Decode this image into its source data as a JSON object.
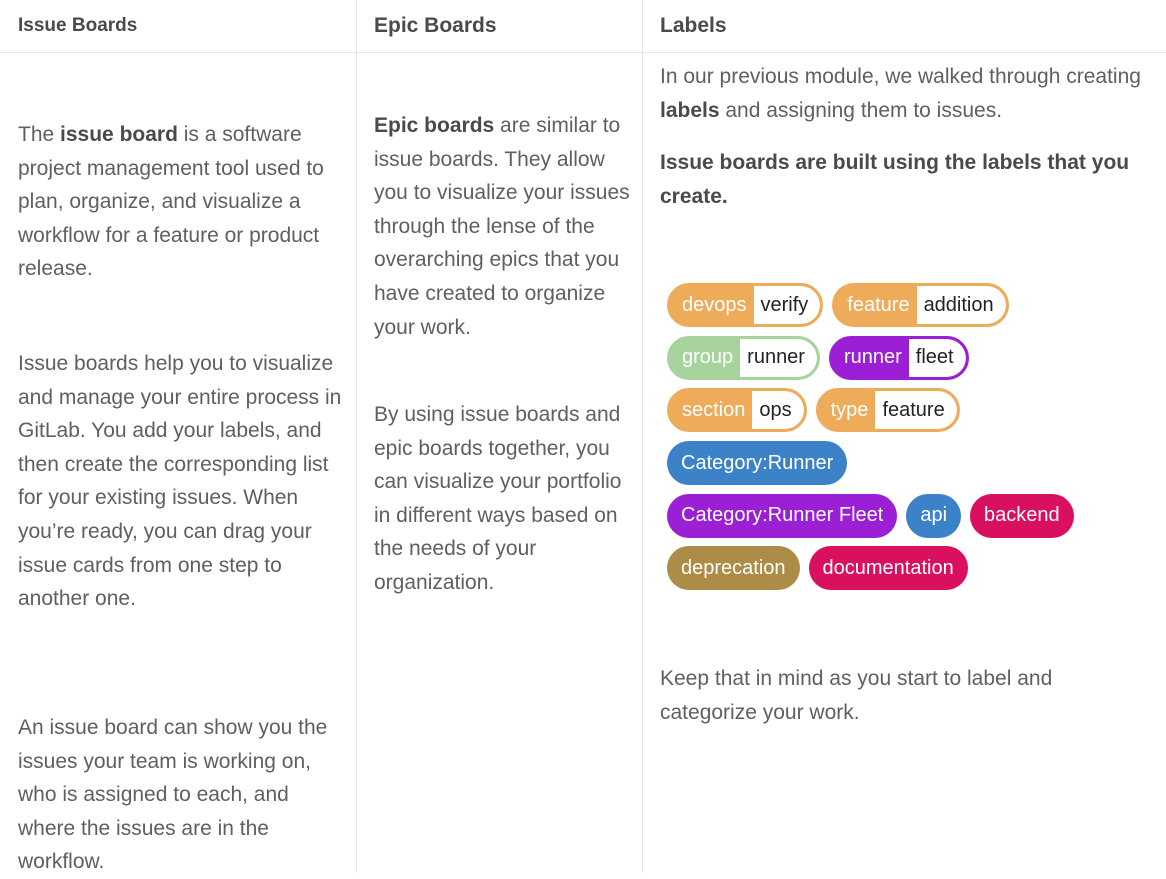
{
  "columns": {
    "issue_boards": {
      "title": "Issue Boards",
      "p1_pre": "The ",
      "p1_bold": "issue board",
      "p1_post": " is a software project management tool used to plan, organize, and visualize a workflow for a feature or product release.",
      "p2": "Issue boards help you to visualize and manage your entire process in GitLab. You add your labels, and then create the corresponding list for your existing issues. When you’re ready, you can drag your issue cards from one step to another one.",
      "p3": "An issue board can show you the issues your team is working on, who is assigned to each, and where the issues are in the workflow."
    },
    "epic_boards": {
      "title": "Epic Boards",
      "p1_bold": "Epic boards",
      "p1_post": " are similar to issue boards. They allow you to visualize your issues through the lense of the overarching epics that you have created to organize your work.",
      "p2": "By using issue boards and epic boards together, you can visualize your portfolio in different ways based on the needs of your organization."
    },
    "labels": {
      "title": "Labels",
      "p1_pre": "In our previous module, we walked through creating ",
      "p1_bold": "labels",
      "p1_post": " and assigning them to issues.",
      "p2": "Issue boards are built using the labels that you create.",
      "p3": "Keep that in mind as you start to label and categorize your work."
    }
  },
  "labels": [
    {
      "key": "devops",
      "value": "verify",
      "color": "#eeac5b"
    },
    {
      "key": "feature",
      "value": "addition",
      "color": "#eeac5b"
    },
    {
      "key": "group",
      "value": "runner",
      "color": "#a6d49c"
    },
    {
      "key": "runner",
      "value": "fleet",
      "color": "#9b1fd4"
    },
    {
      "key": "section",
      "value": "ops",
      "color": "#eeac5b"
    },
    {
      "key": "type",
      "value": "feature",
      "color": "#eeac5b"
    },
    {
      "name": "Category:Runner",
      "color": "#3c82c8"
    },
    {
      "name": "Category:Runner Fleet",
      "color": "#9b1fd4"
    },
    {
      "name": "api",
      "color": "#3c82c8"
    },
    {
      "name": "backend",
      "color": "#d90f60"
    },
    {
      "name": "deprecation",
      "color": "#ac8c46"
    },
    {
      "name": "documentation",
      "color": "#d90f60"
    }
  ]
}
